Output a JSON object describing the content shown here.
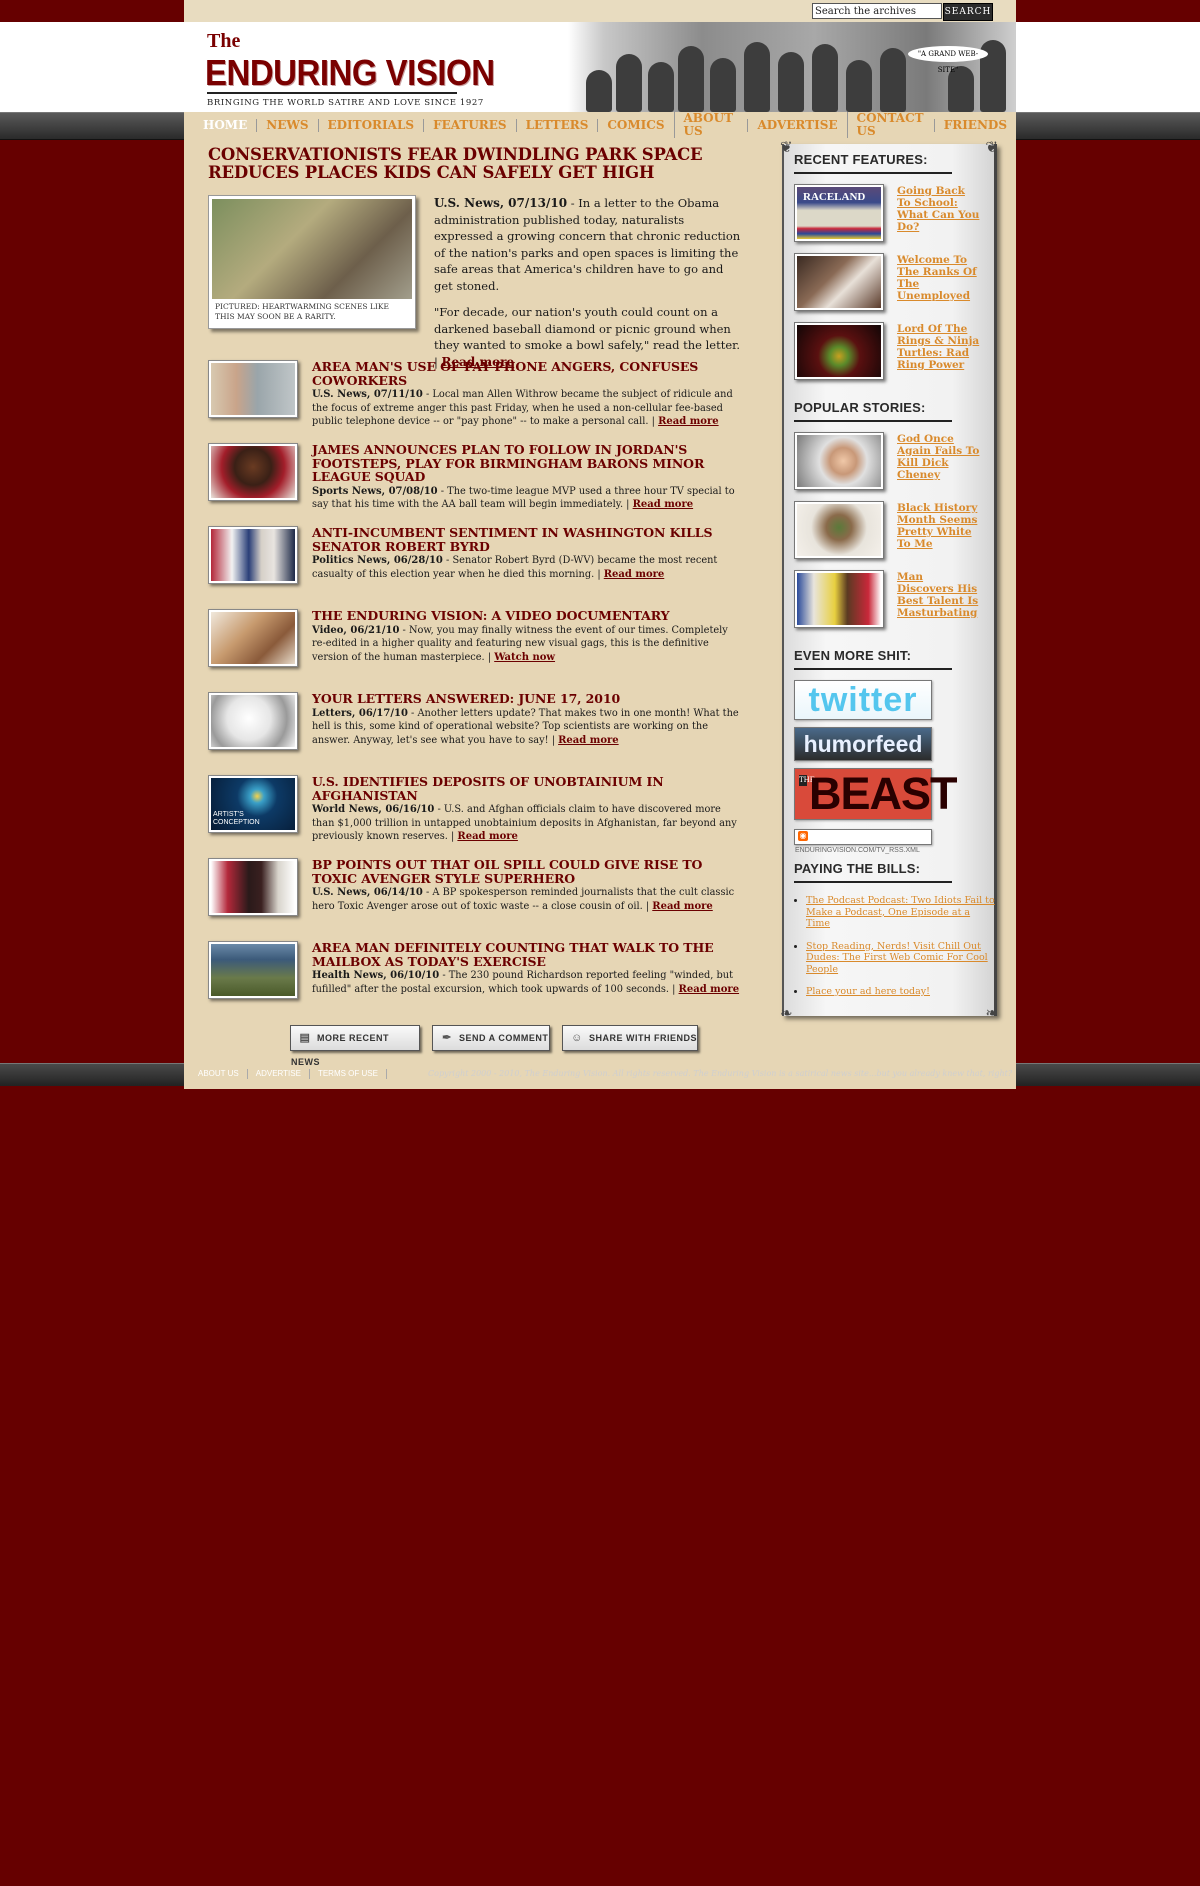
{
  "search": {
    "placeholder": "Search the archives",
    "value": "Search the archives",
    "button_label": "SEARCH"
  },
  "header": {
    "logo_the": "The",
    "logo_name": "ENDURING VISION",
    "tagline": "BRINGING THE WORLD SATIRE AND LOVE SINCE 1927",
    "art_caption": "\"A GRAND WEB-SITE\""
  },
  "nav": [
    "HOME",
    "NEWS",
    "EDITORIALS",
    "FEATURES",
    "LETTERS",
    "COMICS",
    "ABOUT US",
    "ADVERTISE",
    "CONTACT US",
    "FRIENDS"
  ],
  "lead": {
    "title": "CONSERVATIONISTS FEAR DWINDLING PARK SPACE REDUCES PLACES KIDS CAN SAFELY GET HIGH",
    "photo_caption": "PICTURED: HEARTWARMING SCENES LIKE THIS MAY SOON BE A RARITY.",
    "dateline": "U.S. News, 07/13/10",
    "para1": " - In a letter to the Obama administration published today, naturalists expressed a growing concern that chronic reduction of the nation's parks and open spaces is limiting the safe areas that America's children have to go and get stoned.",
    "para2": "\"For decade, our nation's youth could count on a darkened baseball diamond or picnic ground when they wanted to smoke a bowl safely,\" read the letter. | ",
    "read_more": "Read more"
  },
  "stories": [
    {
      "title": "AREA MAN'S USE OF PAY PHONE ANGERS, CONFUSES COWORKERS",
      "dateline": "U.S. News, 07/11/10",
      "text": " - Local man Allen Withrow became the subject of ridicule and the focus of extreme anger this past Friday, when he used a non-cellular fee-based public telephone device -- or \"pay phone\" -- to make a personal call. | ",
      "link": "Read more"
    },
    {
      "title": "JAMES ANNOUNCES PLAN TO FOLLOW IN JORDAN'S FOOTSTEPS, PLAY FOR BIRMINGHAM BARONS MINOR LEAGUE SQUAD",
      "dateline": "Sports News, 07/08/10",
      "text": " - The two-time league MVP used a three hour TV special to say that his time with the AA ball team will begin immediately. | ",
      "link": "Read more"
    },
    {
      "title": "ANTI-INCUMBENT SENTIMENT IN WASHINGTON KILLS SENATOR ROBERT BYRD",
      "dateline": "Politics News, 06/28/10",
      "text": " - Senator Robert Byrd (D-WV) became the most recent casualty of this election year when he died this morning. | ",
      "link": "Read more"
    },
    {
      "title": "THE ENDURING VISION: A VIDEO DOCUMENTARY",
      "dateline": "Video, 06/21/10",
      "text": " - Now, you may finally witness the event of our times. Completely re-edited in a higher quality and featuring new visual gags, this is the definitive version of the human masterpiece. | ",
      "link": "Watch now"
    },
    {
      "title": "YOUR LETTERS ANSWERED: JUNE 17, 2010",
      "dateline": "Letters, 06/17/10",
      "text": " - Another letters update? That makes two in one month! What the hell is this, some kind of operational website? Top scientists are working on the answer. Anyway, let's see what you have to say! | ",
      "link": "Read more"
    },
    {
      "title": "U.S. IDENTIFIES DEPOSITS OF UNOBTAINIUM IN AFGHANISTAN",
      "dateline": "World News, 06/16/10",
      "text": " - U.S. and Afghan officials claim to have discovered more than $1,000 trillion in untapped unobtainium deposits in Afghanistan, far beyond any previously known reserves. | ",
      "link": "Read more",
      "thumb_caption": "ARTIST'S CONCEPTION"
    },
    {
      "title": "BP POINTS OUT THAT OIL SPILL COULD GIVE RISE TO TOXIC AVENGER STYLE SUPERHERO",
      "dateline": "U.S. News, 06/14/10",
      "text": " - A BP spokesperson reminded journalists that the cult classic hero Toxic Avenger arose out of toxic waste -- a close cousin of oil. | ",
      "link": "Read more"
    },
    {
      "title": "AREA MAN DEFINITELY COUNTING THAT WALK TO THE MAILBOX AS TODAY'S EXERCISE",
      "dateline": "Health News, 06/10/10",
      "text": " - The 230 pound Richardson reported feeling \"winded, but fufilled\" after the postal excursion, which took upwards of 100 seconds. | ",
      "link": "Read more"
    }
  ],
  "buttons": {
    "more": "MORE RECENT NEWS",
    "comment": "SEND A COMMENT",
    "share": "SHARE WITH FRIENDS"
  },
  "sidebar": {
    "recent_heading": "RECENT FEATURES:",
    "recent": [
      {
        "label": "Going Back To School: What Can You Do?",
        "thumb_text": "RACELAND"
      },
      {
        "label": "Welcome To The Ranks Of The Unemployed"
      },
      {
        "label": "Lord Of The Rings & Ninja Turtles: Rad Ring Power"
      }
    ],
    "popular_heading": "POPULAR STORIES:",
    "popular": [
      {
        "label": "God Once Again Fails To Kill Dick Cheney"
      },
      {
        "label": "Black History Month Seems Pretty White To Me"
      },
      {
        "label": "Man Discovers His Best Talent Is Masturbating"
      }
    ],
    "more_heading": "EVEN MORE SHIT:",
    "twitter": "twitter",
    "humorfeed": "humorfeed",
    "beast_the": "THE",
    "beast_word": "BEAST",
    "rss": "ENDURINGVISION.COM/TV_RSS.XML",
    "bills_heading": "PAYING THE BILLS:",
    "bills": [
      "The Podcast Podcast: Two Idiots Fail to Make a Podcast, One Episode at a Time",
      "Stop Reading, Nerds! Visit Chill Out Dudes: The First Web Comic For Cool People",
      "Place your ad here today!"
    ]
  },
  "footer": {
    "links": [
      "ABOUT US",
      "ADVERTISE",
      "TERMS OF USE"
    ],
    "copyright": "Copyright 2000 - 2010, The Enduring Vision. All rights reserved. The Enduring Vision is a satirical news site...but you already knew that, right?"
  },
  "colors": {
    "maroon": "#660000",
    "headline": "#6b0000",
    "link_orange": "#d98a2c",
    "parchment": "#e6d6b5"
  }
}
